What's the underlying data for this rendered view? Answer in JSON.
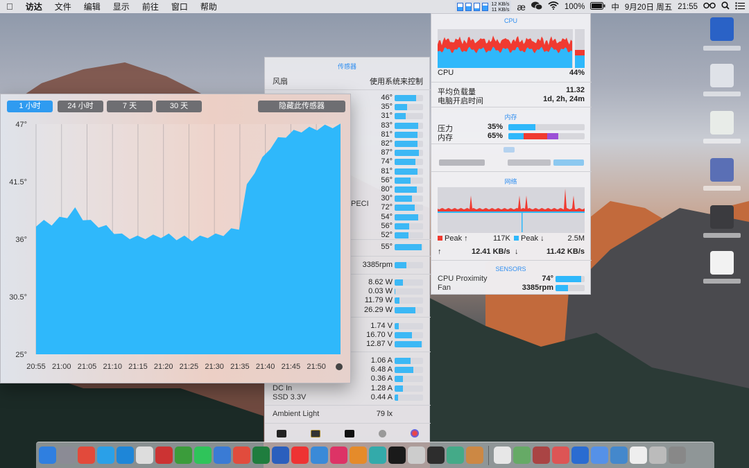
{
  "menubar": {
    "apple": "",
    "items": [
      "访达",
      "文件",
      "编辑",
      "显示",
      "前往",
      "窗口",
      "帮助"
    ],
    "net_up": "12 KB/s",
    "net_down": "11 KB/s",
    "battery": "100%",
    "input_method": "中",
    "date": "9月20日 周五",
    "time": "21:55",
    "icons": [
      "istat-menus-icon",
      "wechat-icon",
      "wifi-icon",
      "battery-icon",
      "spectacles-icon",
      "search-icon",
      "notification-icon"
    ]
  },
  "history": {
    "tabs": [
      "1 小时",
      "24 小时",
      "7 天",
      "30 天"
    ],
    "active_tab": 0,
    "hide_button": "隐藏此传感器",
    "accent": "#2fb8fb",
    "chart_data": {
      "type": "area",
      "x": [
        "20:55",
        "21:00",
        "21:05",
        "21:10",
        "21:15",
        "21:20",
        "21:25",
        "21:30",
        "21:35",
        "21:40",
        "21:45",
        "21:50"
      ],
      "y_ticks": [
        "47°",
        "41.5°",
        "36°",
        "30.5°",
        "25°"
      ],
      "ylim": [
        25,
        47
      ],
      "series": [
        {
          "values": [
            37.4,
            37.6,
            37.5,
            37.9,
            38.2,
            38.8,
            38.0,
            37.6,
            37.3,
            37.1,
            36.7,
            36.3,
            36.2,
            36.1,
            36.2,
            36.2,
            36.3,
            36.3,
            36.1,
            36.1,
            36.0,
            36.1,
            36.3,
            36.3,
            36.5,
            36.8,
            37.1,
            41.0,
            42.5,
            43.6,
            44.8,
            45.5,
            45.9,
            46.2,
            46.4,
            46.5,
            46.6,
            46.7,
            46.8,
            46.8
          ]
        }
      ]
    }
  },
  "sensors": {
    "title": "传感器",
    "fan_label": "风扇",
    "fan_value": "使用系统来控制",
    "temps": [
      {
        "value": "46°",
        "pct": 0.75
      },
      {
        "value": "35°",
        "pct": 0.45
      },
      {
        "value": "31°",
        "pct": 0.38
      },
      {
        "value": "83°",
        "pct": 0.82
      },
      {
        "value": "81°",
        "pct": 0.8
      },
      {
        "value": "82°",
        "pct": 0.81
      },
      {
        "value": "87°",
        "pct": 0.86
      },
      {
        "value": "74°",
        "pct": 0.73
      },
      {
        "value": "81°",
        "pct": 0.8
      },
      {
        "value": "56°",
        "pct": 0.55
      },
      {
        "value": "80°",
        "pct": 0.79
      },
      {
        "value": "30°",
        "pct": 0.62
      },
      {
        "value": "72°",
        "pct": 0.7
      },
      {
        "value": "54°",
        "pct": 0.82
      },
      {
        "value": "56°",
        "pct": 0.5
      },
      {
        "value": "52°",
        "pct": 0.48
      }
    ],
    "peci_label": "PECI",
    "temp2": {
      "value": "55°",
      "pct": 0.95
    },
    "fan_rpm": {
      "value": "3385rpm",
      "pct": 0.42
    },
    "power": [
      {
        "value": "8.62 W",
        "pct": 0.3
      },
      {
        "value": "0.03 W",
        "pct": 0.02
      },
      {
        "value": "11.79 W",
        "pct": 0.18
      },
      {
        "value": "26.29 W",
        "pct": 0.72
      }
    ],
    "voltage": [
      {
        "value": "1.74 V",
        "pct": 0.15
      },
      {
        "value": "16.70 V",
        "pct": 0.6
      },
      {
        "value": "12.87 V",
        "pct": 0.95
      }
    ],
    "current": [
      {
        "label": "",
        "value": "1.06 A",
        "pct": 0.55
      },
      {
        "label": "",
        "value": "6.48 A",
        "pct": 0.65
      },
      {
        "label": "",
        "value": "0.36 A",
        "pct": 0.3
      },
      {
        "label": "DC In",
        "value": "1.28 A",
        "pct": 0.3
      },
      {
        "label": "SSD 3.3V",
        "value": "0.44 A",
        "pct": 0.12
      }
    ],
    "ambient_label": "Ambient Light",
    "ambient_value": "79 lx"
  },
  "istat": {
    "cpu_title": "CPU",
    "cpu_label": "CPU",
    "cpu_pct": "44%",
    "load_label": "平均负载量",
    "load_value": "11.32",
    "uptime_label": "电脑开启时间",
    "uptime_value": "1d, 2h, 24m",
    "mem_title": "内存",
    "pressure_label": "压力",
    "pressure_value": "35%",
    "pressure_pct": 0.35,
    "mem_label": "内存",
    "mem_value": "65%",
    "gpu_title": "",
    "net_title": "网络",
    "peak_up_label": "Peak ↑",
    "peak_up_value": "117K",
    "peak_down_label": "Peak ↓",
    "peak_down_value": "2.5M",
    "up_arrow": "↑",
    "up_rate": "12.41 KB/s",
    "down_rate": "11.42 KB/s",
    "down_arrow": "↓",
    "sensors_title": "SENSORS",
    "s1_label": "CPU Proximity",
    "s1_value": "74°",
    "s1_pct": 0.88,
    "s2_label": "Fan",
    "s2_value": "3385rpm",
    "s2_pct": 0.42,
    "colors": {
      "blue": "#2fb8fb",
      "red": "#f03a30",
      "purple": "#9b4fd6"
    }
  },
  "dock": {
    "apps": [
      "finder-icon",
      "launchpad-icon",
      "chrome-icon",
      "qq-icon",
      "safari-icon",
      "calendar-icon",
      "app-icon",
      "mail-icon",
      "wechat-icon",
      "cloud-icon",
      "app-icon",
      "excel-icon",
      "word-icon",
      "app-icon",
      "photos-icon",
      "app-icon",
      "app-icon",
      "app-icon",
      "app-icon",
      "app-icon",
      "terminal-icon",
      "app-icon",
      "app-icon",
      "app-icon",
      "app-icon",
      "app-icon",
      "app-icon",
      "app-icon",
      "app-icon",
      "app-icon",
      "app-icon",
      "app-icon",
      "trash-icon"
    ]
  }
}
